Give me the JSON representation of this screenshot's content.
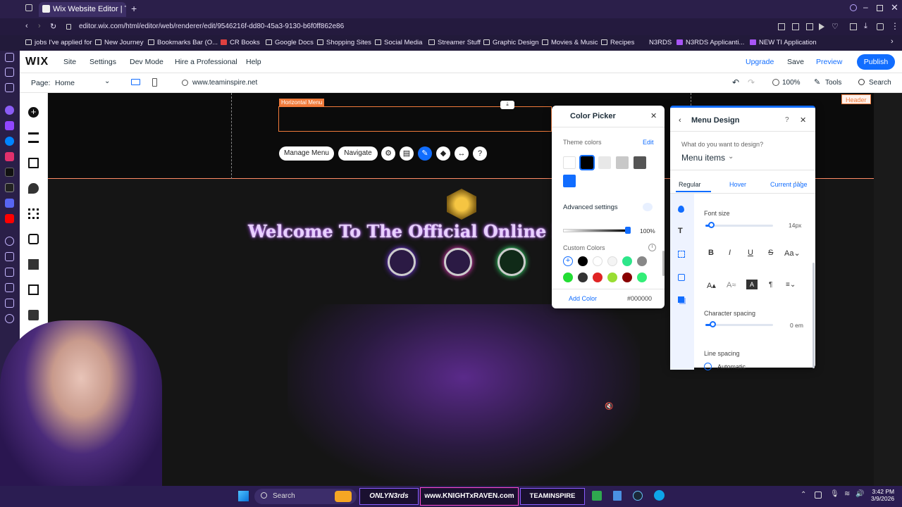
{
  "browser": {
    "tab_title": "Wix Website Editor | Team",
    "url": "editor.wix.com/html/editor/web/renderer/edit/9546216f-dd80-45a3-9130-b6f0ff862e86",
    "bookmarks": [
      "jobs I've applied for",
      "New Journey",
      "Bookmarks Bar (O...",
      "CR Books",
      "Google Docs",
      "Shopping Sites",
      "Social Media",
      "Streamer Stuff",
      "Graphic Design",
      "Movies & Music",
      "Recipes",
      "N3RDS",
      "N3RDS Applicanti...",
      "NEW TI Application"
    ]
  },
  "wix": {
    "logo": "WIX",
    "menu": [
      "Site",
      "Settings",
      "Dev Mode",
      "Hire a Professional",
      "Help"
    ],
    "upgrade": "Upgrade",
    "save": "Save",
    "preview": "Preview",
    "publish": "Publish",
    "page_label": "Page:",
    "page_value": "Home",
    "site_url": "www.teaminspire.net",
    "zoom": "100%",
    "tools": "Tools",
    "search": "Search"
  },
  "canvas": {
    "horizontal_menu_label": "Horizontal Menu",
    "header_tag": "Header",
    "manage_menu": "Manage Menu",
    "navigate": "Navigate",
    "welcome": "Welcome To The Official Online Home"
  },
  "color_picker": {
    "title": "Color Picker",
    "theme_colors": "Theme colors",
    "edit": "Edit",
    "theme_swatches": [
      "#ffffff",
      "#000000",
      "#e8e8e8",
      "#c8c8c8",
      "#555555",
      "#116dff"
    ],
    "advanced": "Advanced settings",
    "opacity": "100%",
    "custom_colors": "Custom Colors",
    "custom_swatches": [
      "#000000",
      "#ffffff",
      "#f4f4f4",
      "#2ee68a",
      "#888888",
      "#22dd33",
      "#333333",
      "#e02424",
      "#99dd33",
      "#880000",
      "#33ee77"
    ],
    "add_color": "Add Color",
    "hex": "#000000"
  },
  "menu_design": {
    "title": "Menu Design",
    "question": "What do you want to design?",
    "selected": "Menu items",
    "tabs": [
      "Regular",
      "Hover",
      "Current page"
    ],
    "font_size_label": "Font size",
    "font_size_value": "14px",
    "char_spacing_label": "Character spacing",
    "char_spacing_value": "0 em",
    "line_spacing_label": "Line spacing",
    "line_spacing_option": "Automatic",
    "font_size_fraction": 0.08,
    "char_spacing_fraction": 0.1
  },
  "taskbar": {
    "search": "Search",
    "app1": "ONLYN3rds",
    "app2": "www.KNIGHTxRAVEN.com",
    "app3": "TEAMINSPIRE",
    "time": "3:42 PM",
    "date": "3/9/2026"
  }
}
